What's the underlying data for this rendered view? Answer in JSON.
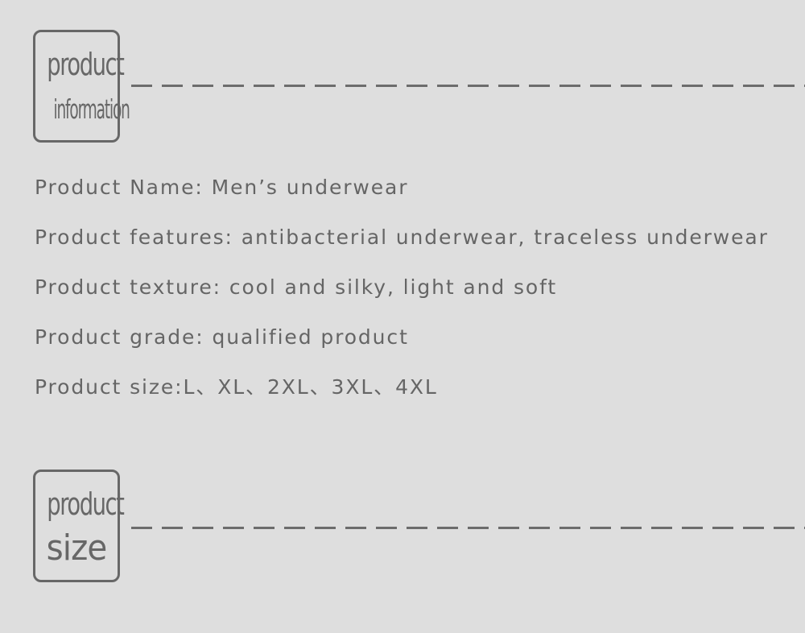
{
  "info_header": {
    "badge_line1": "product",
    "badge_line2": "information"
  },
  "product_info": {
    "lines": [
      "Product Name: Men’s underwear",
      "Product features: antibacterial underwear, traceless underwear",
      "Product texture: cool and silky, light and soft",
      "Product grade: qualified product",
      "Product size:L、XL、2XL、3XL、4XL"
    ]
  },
  "size_header": {
    "badge_line1": "product",
    "badge_line2": "size"
  },
  "colors": {
    "background": "#dedede",
    "text": "#656565",
    "border": "#676767"
  }
}
